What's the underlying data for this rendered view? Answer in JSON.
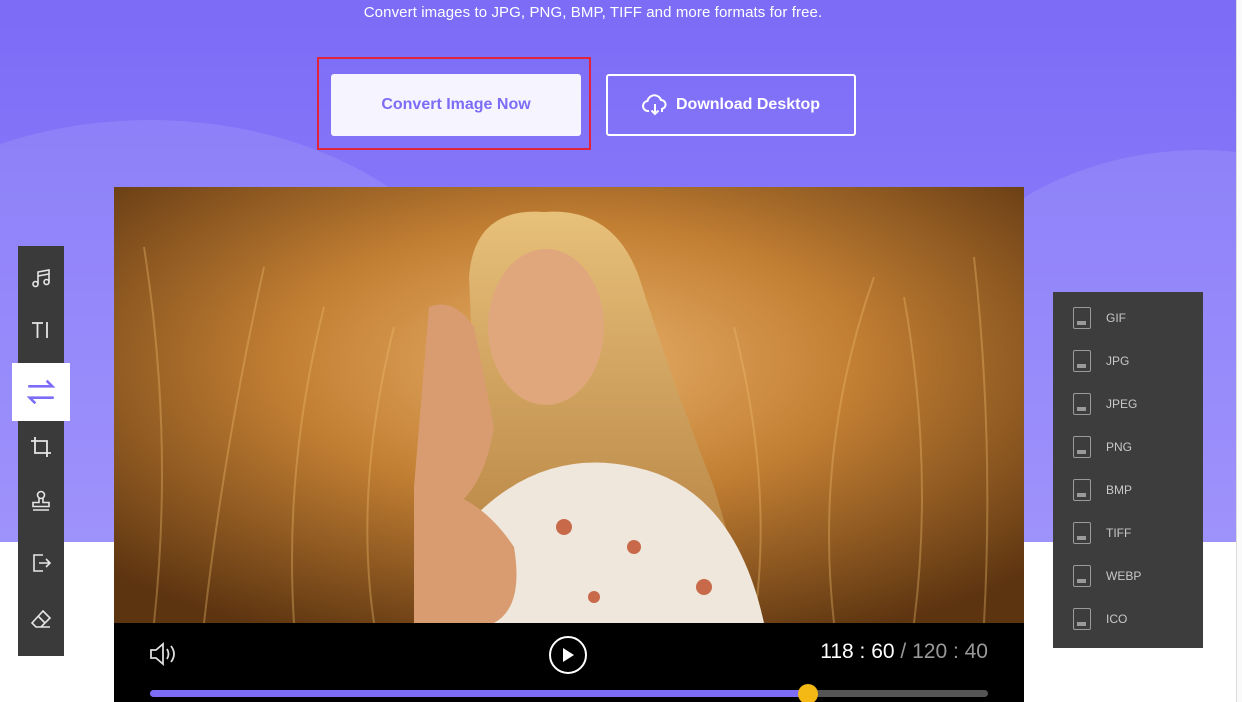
{
  "hero": {
    "subtitle": "Convert images to JPG, PNG, BMP, TIFF and more formats for free.",
    "primary_button": "Convert Image Now",
    "secondary_button": "Download Desktop"
  },
  "colors": {
    "accent": "#7c6cf6",
    "highlight_border": "#e0243a",
    "knob": "#f5b915"
  },
  "player": {
    "current_time": "118 : 60",
    "total_time": "/ 120 : 40",
    "progress": 0.785
  },
  "left_toolbar": {
    "tools": [
      {
        "icon": "music-icon"
      },
      {
        "icon": "text-icon"
      },
      {
        "icon": "convert-icon",
        "active": true
      },
      {
        "icon": "crop-icon"
      },
      {
        "icon": "stamp-icon"
      },
      {
        "icon": "export-icon"
      },
      {
        "icon": "eraser-icon"
      }
    ]
  },
  "formats": [
    "GIF",
    "JPG",
    "JPEG",
    "PNG",
    "BMP",
    "TIFF",
    "WEBP",
    "ICO"
  ]
}
